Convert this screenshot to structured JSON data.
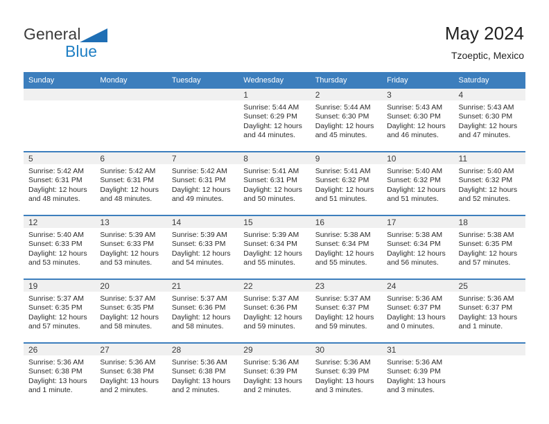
{
  "brand": {
    "name_top": "General",
    "name_bottom": "Blue",
    "triangle_color": "#1f6fb5",
    "text_color": "#3b3b3b",
    "blue_color": "#1f7fc4"
  },
  "header": {
    "title": "May 2024",
    "subtitle": "Tzoeptic, Mexico"
  },
  "colors": {
    "header_bar": "#3c7ebd",
    "day_band": "#f0f0f0",
    "row_divider": "#3c7ebd",
    "text": "#2b2b2b"
  },
  "weekday_headers": [
    "Sunday",
    "Monday",
    "Tuesday",
    "Wednesday",
    "Thursday",
    "Friday",
    "Saturday"
  ],
  "weeks": [
    [
      {
        "day": "",
        "sunrise": "",
        "sunset": "",
        "daylight1": "",
        "daylight2": ""
      },
      {
        "day": "",
        "sunrise": "",
        "sunset": "",
        "daylight1": "",
        "daylight2": ""
      },
      {
        "day": "",
        "sunrise": "",
        "sunset": "",
        "daylight1": "",
        "daylight2": ""
      },
      {
        "day": "1",
        "sunrise": "Sunrise: 5:44 AM",
        "sunset": "Sunset: 6:29 PM",
        "daylight1": "Daylight: 12 hours",
        "daylight2": "and 44 minutes."
      },
      {
        "day": "2",
        "sunrise": "Sunrise: 5:44 AM",
        "sunset": "Sunset: 6:30 PM",
        "daylight1": "Daylight: 12 hours",
        "daylight2": "and 45 minutes."
      },
      {
        "day": "3",
        "sunrise": "Sunrise: 5:43 AM",
        "sunset": "Sunset: 6:30 PM",
        "daylight1": "Daylight: 12 hours",
        "daylight2": "and 46 minutes."
      },
      {
        "day": "4",
        "sunrise": "Sunrise: 5:43 AM",
        "sunset": "Sunset: 6:30 PM",
        "daylight1": "Daylight: 12 hours",
        "daylight2": "and 47 minutes."
      }
    ],
    [
      {
        "day": "5",
        "sunrise": "Sunrise: 5:42 AM",
        "sunset": "Sunset: 6:31 PM",
        "daylight1": "Daylight: 12 hours",
        "daylight2": "and 48 minutes."
      },
      {
        "day": "6",
        "sunrise": "Sunrise: 5:42 AM",
        "sunset": "Sunset: 6:31 PM",
        "daylight1": "Daylight: 12 hours",
        "daylight2": "and 48 minutes."
      },
      {
        "day": "7",
        "sunrise": "Sunrise: 5:42 AM",
        "sunset": "Sunset: 6:31 PM",
        "daylight1": "Daylight: 12 hours",
        "daylight2": "and 49 minutes."
      },
      {
        "day": "8",
        "sunrise": "Sunrise: 5:41 AM",
        "sunset": "Sunset: 6:31 PM",
        "daylight1": "Daylight: 12 hours",
        "daylight2": "and 50 minutes."
      },
      {
        "day": "9",
        "sunrise": "Sunrise: 5:41 AM",
        "sunset": "Sunset: 6:32 PM",
        "daylight1": "Daylight: 12 hours",
        "daylight2": "and 51 minutes."
      },
      {
        "day": "10",
        "sunrise": "Sunrise: 5:40 AM",
        "sunset": "Sunset: 6:32 PM",
        "daylight1": "Daylight: 12 hours",
        "daylight2": "and 51 minutes."
      },
      {
        "day": "11",
        "sunrise": "Sunrise: 5:40 AM",
        "sunset": "Sunset: 6:32 PM",
        "daylight1": "Daylight: 12 hours",
        "daylight2": "and 52 minutes."
      }
    ],
    [
      {
        "day": "12",
        "sunrise": "Sunrise: 5:40 AM",
        "sunset": "Sunset: 6:33 PM",
        "daylight1": "Daylight: 12 hours",
        "daylight2": "and 53 minutes."
      },
      {
        "day": "13",
        "sunrise": "Sunrise: 5:39 AM",
        "sunset": "Sunset: 6:33 PM",
        "daylight1": "Daylight: 12 hours",
        "daylight2": "and 53 minutes."
      },
      {
        "day": "14",
        "sunrise": "Sunrise: 5:39 AM",
        "sunset": "Sunset: 6:33 PM",
        "daylight1": "Daylight: 12 hours",
        "daylight2": "and 54 minutes."
      },
      {
        "day": "15",
        "sunrise": "Sunrise: 5:39 AM",
        "sunset": "Sunset: 6:34 PM",
        "daylight1": "Daylight: 12 hours",
        "daylight2": "and 55 minutes."
      },
      {
        "day": "16",
        "sunrise": "Sunrise: 5:38 AM",
        "sunset": "Sunset: 6:34 PM",
        "daylight1": "Daylight: 12 hours",
        "daylight2": "and 55 minutes."
      },
      {
        "day": "17",
        "sunrise": "Sunrise: 5:38 AM",
        "sunset": "Sunset: 6:34 PM",
        "daylight1": "Daylight: 12 hours",
        "daylight2": "and 56 minutes."
      },
      {
        "day": "18",
        "sunrise": "Sunrise: 5:38 AM",
        "sunset": "Sunset: 6:35 PM",
        "daylight1": "Daylight: 12 hours",
        "daylight2": "and 57 minutes."
      }
    ],
    [
      {
        "day": "19",
        "sunrise": "Sunrise: 5:37 AM",
        "sunset": "Sunset: 6:35 PM",
        "daylight1": "Daylight: 12 hours",
        "daylight2": "and 57 minutes."
      },
      {
        "day": "20",
        "sunrise": "Sunrise: 5:37 AM",
        "sunset": "Sunset: 6:35 PM",
        "daylight1": "Daylight: 12 hours",
        "daylight2": "and 58 minutes."
      },
      {
        "day": "21",
        "sunrise": "Sunrise: 5:37 AM",
        "sunset": "Sunset: 6:36 PM",
        "daylight1": "Daylight: 12 hours",
        "daylight2": "and 58 minutes."
      },
      {
        "day": "22",
        "sunrise": "Sunrise: 5:37 AM",
        "sunset": "Sunset: 6:36 PM",
        "daylight1": "Daylight: 12 hours",
        "daylight2": "and 59 minutes."
      },
      {
        "day": "23",
        "sunrise": "Sunrise: 5:37 AM",
        "sunset": "Sunset: 6:37 PM",
        "daylight1": "Daylight: 12 hours",
        "daylight2": "and 59 minutes."
      },
      {
        "day": "24",
        "sunrise": "Sunrise: 5:36 AM",
        "sunset": "Sunset: 6:37 PM",
        "daylight1": "Daylight: 13 hours",
        "daylight2": "and 0 minutes."
      },
      {
        "day": "25",
        "sunrise": "Sunrise: 5:36 AM",
        "sunset": "Sunset: 6:37 PM",
        "daylight1": "Daylight: 13 hours",
        "daylight2": "and 1 minute."
      }
    ],
    [
      {
        "day": "26",
        "sunrise": "Sunrise: 5:36 AM",
        "sunset": "Sunset: 6:38 PM",
        "daylight1": "Daylight: 13 hours",
        "daylight2": "and 1 minute."
      },
      {
        "day": "27",
        "sunrise": "Sunrise: 5:36 AM",
        "sunset": "Sunset: 6:38 PM",
        "daylight1": "Daylight: 13 hours",
        "daylight2": "and 2 minutes."
      },
      {
        "day": "28",
        "sunrise": "Sunrise: 5:36 AM",
        "sunset": "Sunset: 6:38 PM",
        "daylight1": "Daylight: 13 hours",
        "daylight2": "and 2 minutes."
      },
      {
        "day": "29",
        "sunrise": "Sunrise: 5:36 AM",
        "sunset": "Sunset: 6:39 PM",
        "daylight1": "Daylight: 13 hours",
        "daylight2": "and 2 minutes."
      },
      {
        "day": "30",
        "sunrise": "Sunrise: 5:36 AM",
        "sunset": "Sunset: 6:39 PM",
        "daylight1": "Daylight: 13 hours",
        "daylight2": "and 3 minutes."
      },
      {
        "day": "31",
        "sunrise": "Sunrise: 5:36 AM",
        "sunset": "Sunset: 6:39 PM",
        "daylight1": "Daylight: 13 hours",
        "daylight2": "and 3 minutes."
      },
      {
        "day": "",
        "sunrise": "",
        "sunset": "",
        "daylight1": "",
        "daylight2": ""
      }
    ]
  ]
}
